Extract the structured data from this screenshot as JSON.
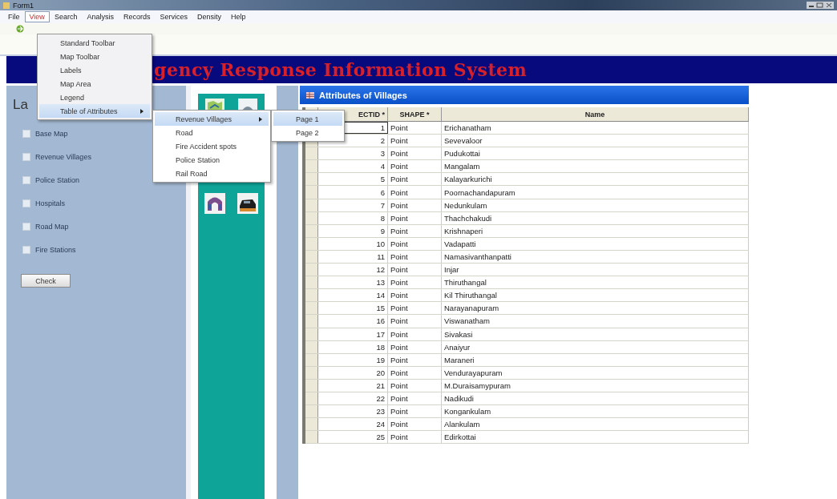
{
  "window": {
    "title": "Form1"
  },
  "menu": [
    {
      "label": "File",
      "selected": false
    },
    {
      "label": "View",
      "selected": true
    },
    {
      "label": "Search",
      "selected": false
    },
    {
      "label": "Analysis",
      "selected": false
    },
    {
      "label": "Records",
      "selected": false
    },
    {
      "label": "Services",
      "selected": false
    },
    {
      "label": "Density",
      "selected": false
    },
    {
      "label": "Help",
      "selected": false
    }
  ],
  "banner": {
    "title": "gency Response Information System"
  },
  "layers": {
    "heading": "La",
    "items": [
      {
        "label": "Base Map",
        "checked": false
      },
      {
        "label": "Revenue Villages",
        "checked": false
      },
      {
        "label": "Police Station",
        "checked": false
      },
      {
        "label": "Hospitals",
        "checked": false
      },
      {
        "label": "Road Map",
        "checked": false
      },
      {
        "label": "Fire Stations",
        "checked": false
      }
    ],
    "button": "Check"
  },
  "attribute_window": {
    "title": "Attributes of Villages",
    "columns": [
      "ECTID *",
      "SHAPE *",
      "Name"
    ],
    "rows": [
      {
        "id": "1",
        "shape": "Point",
        "name": "Erichanatham",
        "selected": true
      },
      {
        "id": "2",
        "shape": "Point",
        "name": "Sevevaloor",
        "selected": false
      },
      {
        "id": "3",
        "shape": "Point",
        "name": "Pudukottai",
        "selected": false
      },
      {
        "id": "4",
        "shape": "Point",
        "name": "Mangalam",
        "selected": false
      },
      {
        "id": "5",
        "shape": "Point",
        "name": "Kalayarkurichi",
        "selected": false
      },
      {
        "id": "6",
        "shape": "Point",
        "name": "Poornachandapuram",
        "selected": false
      },
      {
        "id": "7",
        "shape": "Point",
        "name": "Nedunkulam",
        "selected": false
      },
      {
        "id": "8",
        "shape": "Point",
        "name": "Thachchakudi",
        "selected": false
      },
      {
        "id": "9",
        "shape": "Point",
        "name": "Krishnaperi",
        "selected": false
      },
      {
        "id": "10",
        "shape": "Point",
        "name": "Vadapatti",
        "selected": false
      },
      {
        "id": "11",
        "shape": "Point",
        "name": "Namasivanthanpatti",
        "selected": false
      },
      {
        "id": "12",
        "shape": "Point",
        "name": "Injar",
        "selected": false
      },
      {
        "id": "13",
        "shape": "Point",
        "name": "Thiruthangal",
        "selected": false
      },
      {
        "id": "14",
        "shape": "Point",
        "name": "Kil Thiruthangal",
        "selected": false
      },
      {
        "id": "15",
        "shape": "Point",
        "name": "Narayanapuram",
        "selected": false
      },
      {
        "id": "16",
        "shape": "Point",
        "name": "Viswanatham",
        "selected": false
      },
      {
        "id": "17",
        "shape": "Point",
        "name": "Sivakasi",
        "selected": false
      },
      {
        "id": "18",
        "shape": "Point",
        "name": "Anaiyur",
        "selected": false
      },
      {
        "id": "19",
        "shape": "Point",
        "name": "Maraneri",
        "selected": false
      },
      {
        "id": "20",
        "shape": "Point",
        "name": "Vendurayapuram",
        "selected": false
      },
      {
        "id": "21",
        "shape": "Point",
        "name": "M.Duraisamypuram",
        "selected": false
      },
      {
        "id": "22",
        "shape": "Point",
        "name": "Nadikudi",
        "selected": false
      },
      {
        "id": "23",
        "shape": "Point",
        "name": "Kongankulam",
        "selected": false
      },
      {
        "id": "24",
        "shape": "Point",
        "name": "Alankulam",
        "selected": false
      },
      {
        "id": "25",
        "shape": "Point",
        "name": "Edirkottai",
        "selected": false
      }
    ]
  },
  "view_menu": [
    {
      "label": "Standard Toolbar",
      "selected": false,
      "has_submenu": false
    },
    {
      "label": "Map Toolbar",
      "selected": false,
      "has_submenu": false
    },
    {
      "label": "Labels",
      "selected": false,
      "has_submenu": false
    },
    {
      "label": "Map Area",
      "selected": false,
      "has_submenu": false
    },
    {
      "label": "Legend",
      "selected": false,
      "has_submenu": false
    },
    {
      "label": "Table of Attributes",
      "selected": true,
      "has_submenu": true
    }
  ],
  "attributes_submenu": [
    {
      "label": "Revenue Villages",
      "selected": true,
      "has_submenu": true
    },
    {
      "label": "Road",
      "selected": false,
      "has_submenu": false
    },
    {
      "label": "Fire Accident spots",
      "selected": false,
      "has_submenu": false
    },
    {
      "label": "Police Station",
      "selected": false,
      "has_submenu": false
    },
    {
      "label": "Rail Road",
      "selected": false,
      "has_submenu": false
    }
  ],
  "pages_submenu": [
    {
      "label": "Page 1",
      "selected": true
    },
    {
      "label": "Page 2",
      "selected": false
    }
  ]
}
